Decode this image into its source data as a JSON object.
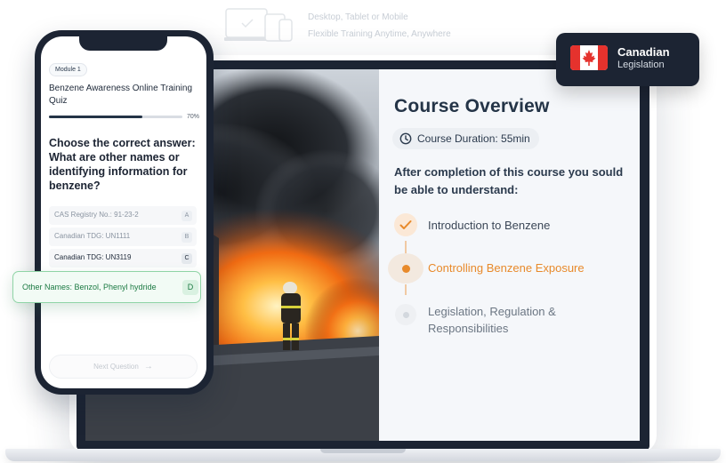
{
  "header": {
    "caption_line1": "Desktop, Tablet or Mobile",
    "caption_line2": "Flexible Training Anytime, Anywhere"
  },
  "badge": {
    "line1": "Canadian",
    "line2": "Legislation",
    "flag_icon": "canada-flag-icon"
  },
  "course": {
    "title": "Course Overview",
    "duration": "Course Duration: 55min",
    "intro": "After completion of this course you sould be able to understand:",
    "steps": [
      {
        "label": "Introduction to Benzene",
        "state": "complete"
      },
      {
        "label": "Controlling Benzene Exposure",
        "state": "current"
      },
      {
        "label": "Legislation, Regulation & Responsibilities",
        "state": "upcoming"
      }
    ],
    "accent_color": "#e88a2b",
    "dark_color": "#243447"
  },
  "quiz": {
    "module": "Module 1",
    "title": "Benzene Awareness Online Training Quiz",
    "progress_percent": 70,
    "progress_label": "70%",
    "question": "Choose the correct answer: What are other names or identifying information for benzene?",
    "answers": [
      {
        "text": "CAS Registry No.: 91-23-2",
        "key": "A"
      },
      {
        "text": "Canadian TDG: UN1111",
        "key": "B"
      },
      {
        "text": "Canadian TDG: UN3119",
        "key": "C"
      },
      {
        "text": "Other Names: Benzol, Phenyl hydride",
        "key": "D",
        "selected": true
      }
    ],
    "next_label": "Next Question",
    "selected_color": "#1c7a43"
  }
}
